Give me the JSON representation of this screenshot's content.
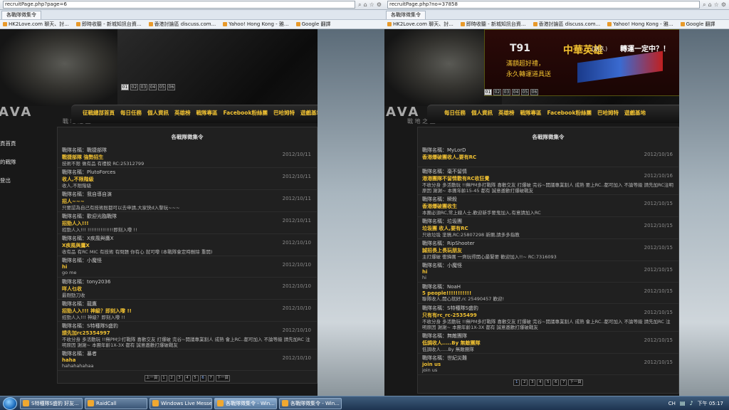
{
  "windows": {
    "left": {
      "address": "recruitPage.php?page=6",
      "tab_title": "各戰隊徵集令",
      "favorites": [
        "HK2Love.com 聊天、討...",
        "即時收聽 - 新城知訊台資...",
        "香港討論區 discuss.com...",
        "Yahoo! Hong Kong - 雅...",
        "Google 翻譯"
      ],
      "side_menu": [
        "頁首頁",
        "的戰隊",
        "登出"
      ],
      "slides": [
        "01",
        "02",
        "03",
        "04",
        "05",
        "06"
      ],
      "logo": "AVA",
      "logo_sub": "戰 地 之 王",
      "nav": [
        "征戰總部首頁",
        "每日任務",
        "個人資訊",
        "英雄榜",
        "戰隊專區",
        "Facebook粉絲團",
        "巴哈姆特",
        "遊戲基地"
      ],
      "panel_title": "各戰隊徵集令",
      "entries": [
        {
          "team": "戰隊名稱：戰捷部隊",
          "headline": "戰捷部隊 強勢招生",
          "body": "技術不限 做有品 有禮貌 RC:25312799",
          "date": "2012/10/11"
        },
        {
          "team": "戰隊名稱：PlutoForces",
          "headline": "收人,不限階級",
          "body": "收人,不限階級",
          "date": "2012/10/11"
        },
        {
          "team": "戰隊名稱：我自導自演",
          "headline": "招人~~~",
          "body": "只要認為自己有技術既都可以去申請,大家快d入黎玩~~~",
          "date": "2012/10/11"
        },
        {
          "team": "戰隊名稱：歡迎光臨戰隊",
          "headline": "招勁人入!!!",
          "body": "招勁人入!!! !!!!!!!!!!!!!!即刻入嚟 !!",
          "date": "2012/10/11"
        },
        {
          "team": "戰隊名稱：X疾風與鷹X",
          "headline": "X疾風與鷹X",
          "body": "收有品 有RC MIC 有技術 有問題 你有心 就可嚟 (本戰隊會定時刪除 重開)",
          "date": "2012/10/10"
        },
        {
          "team": "戰隊名稱：小魔怪",
          "headline": "hi",
          "body": "go me",
          "date": "2012/10/10"
        },
        {
          "team": "戰隊名稱：tony2036",
          "headline": "咩人乜收",
          "body": "最剛勁刀收",
          "date": "2012/10/10"
        },
        {
          "team": "戰隊名稱：龍鷹",
          "headline": "招勁人入!!! 神級？即刻入嚟 !!",
          "body": "招勁人入!!! 神級？即刻入嚟 !!",
          "date": "2012/10/10"
        },
        {
          "team": "戰隊名稱：S特種隊S盛豹",
          "headline": "請先加rc25354997",
          "body": "不收分身 多活動玩 !!無PM少打戰隊 喜歡交友 打爆破 完谷~開議專業割人 成熟 會上RC..都可加入 不論等級 請先加RC 注明原因 謝謝~ 本團年齡1X-3X 都有 誠意邀歡打爆破戰友",
          "date": "2012/10/10"
        },
        {
          "team": "戰隊名稱：暴者",
          "headline": "haha",
          "body": "hahahahahaa",
          "date": "2012/10/10"
        }
      ],
      "pager": [
        "上一頁",
        "1",
        "2",
        "3",
        "4",
        "5",
        "6",
        "7",
        "下一頁"
      ],
      "current_page": "6"
    },
    "right": {
      "address": "recruitPage.php?no=37858",
      "tab_title": "各戰隊徵集令",
      "favorites": [
        "HK2Love.com 聊天、討...",
        "即時收聽 - 新城知訊台資...",
        "香港討論區 discuss.com...",
        "Yahoo! Hong Kong - 雅...",
        "Google 翻譯"
      ],
      "ad": {
        "brand": "T91",
        "title": "中華英雄",
        "sub": "(永久)",
        "ask": "轉運一定中？！",
        "line1": "滿額超好禮，",
        "line2": "永久轉運道具送"
      },
      "slides": [
        "01",
        "02",
        "03",
        "04",
        "05",
        "06"
      ],
      "logo": "AVA",
      "logo_sub": "戰 地 之 王",
      "nav": [
        "每日任務",
        "個人資訊",
        "英雄榜",
        "戰隊專區",
        "Facebook粉絲團",
        "巴哈姆特",
        "遊戲基地"
      ],
      "panel_title": "各戰隊徵集令",
      "entries": [
        {
          "team": "戰隊名稱：MyLorD",
          "headline": "香港爆破團收人,要有RC",
          "body": "",
          "date": "2012/10/16"
        },
        {
          "team": "戰隊名稱：毫不留情",
          "headline": "港港團隊不留情歡有RC收狂覺",
          "body": "不收分身 多活動玩 !!無PM多打戰隊 喜歡交友 打爆破 完谷~開議專業割人 成熟 要上RC..都可加入 不論等級 請先加RC注明原因 謝謝~ 本團年齡15-45 都有 誠意邀歡打爆破戰友",
          "date": "2012/10/16"
        },
        {
          "team": "戰隊名稱：瞬殺",
          "headline": "香港爆破團收生",
          "body": "本團必須RC,常上線人士,歡迎新手要鬼加入,有意請加入RC",
          "date": "2012/10/15"
        },
        {
          "team": "戰隊名稱：垃圾團",
          "headline": "垃圾團 收人,要有RC",
          "body": "只收垃圾 塗鴉,RC:25807298 新團,請多多指教",
          "date": "2012/10/15"
        },
        {
          "team": "戰隊名稱：RipShooter",
          "headline": "誠招長上長玩朋友",
          "body": "主打爆破 衝鋒團 一齊玩得開心最緊要 歡迎加入!!~ RC:7316093",
          "date": "2012/10/15"
        },
        {
          "team": "戰隊名稱：小魔怪",
          "headline": "hi",
          "body": "hi",
          "date": "2012/10/15"
        },
        {
          "team": "戰隊名稱：NoaH",
          "headline": "5 people!!!!!!!!!!!",
          "body": "聯隊收人,開心就好,rc 25490457 歡迎!",
          "date": "2012/10/15"
        },
        {
          "team": "戰隊名稱：S特種隊S盛豹",
          "headline": "只有有rc_rc-2535499",
          "body": "不收分身 多活動玩 !!無PM多打戰隊 喜歡交友 打爆破 完谷~開議專業割人 成熟 會上RC..都可加入 不論等級 請先加RC 注明原因 謝謝~ 本團年齡1X-3X 都有 誠意邀歡打爆破戰友",
          "date": "2012/10/15"
        },
        {
          "team": "戰隊名稱：無敵團隊",
          "headline": "低調收人.....By 無敵團隊",
          "body": "低調收人.....By 無敵團隊",
          "date": "2012/10/15"
        },
        {
          "team": "戰隊名稱：世紀災難",
          "headline": "join us",
          "body": "join us",
          "date": "2012/10/15"
        }
      ],
      "pager": [
        "1",
        "2",
        "3",
        "4",
        "5",
        "6",
        "7",
        "下一頁"
      ],
      "current_page": "1"
    }
  },
  "taskbar": {
    "tasks": [
      {
        "label": "S特種隊S盛豹 好友..."
      },
      {
        "label": "RaidCall"
      },
      {
        "label": "Windows Live Messe..."
      },
      {
        "label": "各戰隊徵集令 - Win..."
      },
      {
        "label": "各戰隊徵集令 - Win..."
      }
    ],
    "lang": "CH",
    "time": "下午 05:17"
  }
}
